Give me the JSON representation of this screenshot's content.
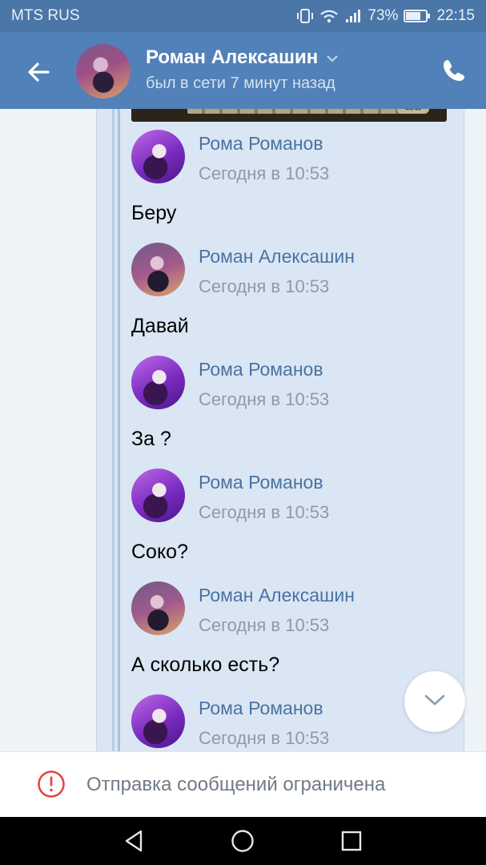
{
  "status_bar": {
    "carrier": "MTS RUS",
    "battery": "73%",
    "time": "22:15",
    "icons": [
      "vibrate-icon",
      "wifi-icon",
      "signal-icon",
      "battery-icon"
    ]
  },
  "header": {
    "name": "Роман Алексашин",
    "status": "был в сети 7 минут назад",
    "icons": [
      "back-arrow-icon",
      "chevron-down-icon",
      "phone-icon"
    ]
  },
  "messages": [
    {
      "author": "Рома Романов",
      "time": "Сегодня в 10:53",
      "text": "Беру"
    },
    {
      "author": "Роман Алексашин",
      "time": "Сегодня в 10:53",
      "text": "Давай"
    },
    {
      "author": "Рома Романов",
      "time": "Сегодня в 10:53",
      "text": "За ?"
    },
    {
      "author": "Рома Романов",
      "time": "Сегодня в 10:53",
      "text": "Соко?"
    },
    {
      "author": "Роман Алексашин",
      "time": "Сегодня в 10:53",
      "text": "А сколько есть?"
    },
    {
      "author": "Рома Романов",
      "time": "Сегодня в 10:53",
      "text": ""
    }
  ],
  "restriction": {
    "text": "Отправка сообщений ограничена",
    "icon": "warning-circle-icon"
  },
  "colors": {
    "header": "#5181b8",
    "status_bar": "#4a76a8",
    "author_link": "#4a73a0",
    "warning": "#e64646"
  }
}
